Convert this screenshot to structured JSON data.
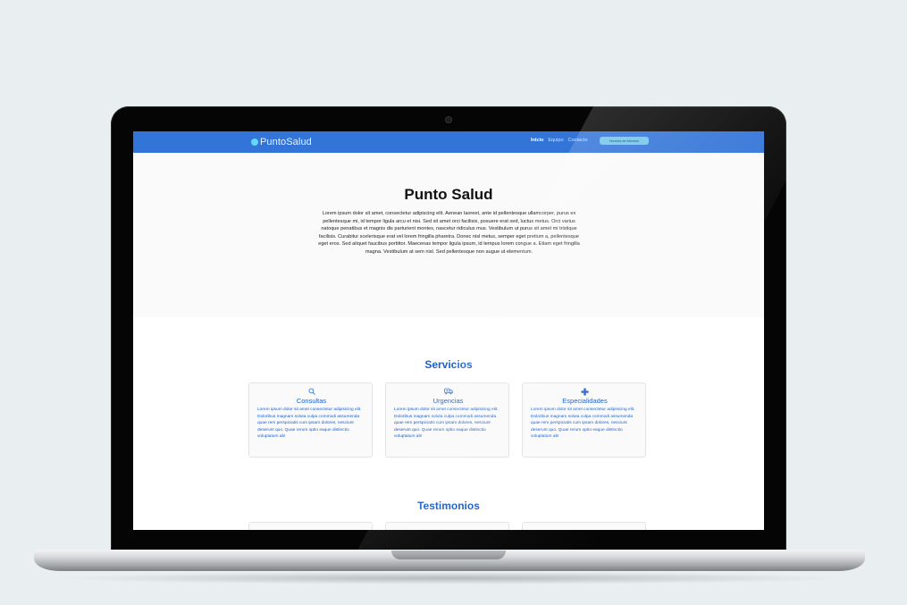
{
  "navbar": {
    "logo_text": "PuntoSalud",
    "links": [
      "Inicio",
      "Equipo",
      "Contacto"
    ],
    "cta_label": "Horarios de Atención"
  },
  "hero": {
    "title": "Punto Salud",
    "text": "Lorem ipsum dolor sit amet, consectetur adipiscing elit. Aenean laoreet, ante id pellentesque ullamcorper, purus ex pellentesque mi, id tempor ligula arcu et nisi. Sed sit amet orci facilisis, posuere erat sed, luctus metus. Orci varius natoque penatibus et magnis dis parturient montes, nascetur ridiculus mus. Vestibulum ut purus sit amet mi tristique facilisis. Curabitur scelerisque erat vel lorem fringilla pharetra. Donec nisl metus, semper eget pretium a, pellentesque eget eros. Sed aliquet faucibus porttitor. Maecenas tempor ligula ipsum, id tempus lorem congue a. Etiam eget fringilla magna. Vestibulum at sem nisl. Sed pellentesque non augue ut elementum."
  },
  "services": {
    "title": "Servicios",
    "cards": [
      {
        "icon": "search-icon",
        "title": "Consultas",
        "text": "Lorem ipsum dolor sit amet consectetur adipisicing elit. Doloribus magnam soluta culpa commodi assumenda quae rem perspiciatis cum ipsam dolores, nesciunt deserunt quo. Quae rerum optio eaque distinctio voluptatum ab!"
      },
      {
        "icon": "ambulance-icon",
        "title": "Urgencias",
        "text": "Lorem ipsum dolor sit amet consectetur adipisicing elit. Doloribus magnam soluta culpa commodi assumenda quae rem perspiciatis cum ipsam dolores, nesciunt deserunt quo. Quae rerum optio eaque distinctio voluptatum ab!"
      },
      {
        "icon": "plus-icon",
        "title": "Especialidades",
        "text": "Lorem ipsum dolor sit amet consectetur adipisicing elit. Doloribus magnam soluta culpa commodi assumenda quae rem perspiciatis cum ipsam dolores, nesciunt deserunt quo. Quae rerum optio eaque distinctio voluptatum ab!"
      }
    ]
  },
  "testimonials": {
    "title": "Testimonios"
  },
  "colors": {
    "navbar": "#3274d8",
    "accent": "#1d5fc9",
    "cta": "#74c6ea",
    "page_background": "#e9eff0"
  }
}
